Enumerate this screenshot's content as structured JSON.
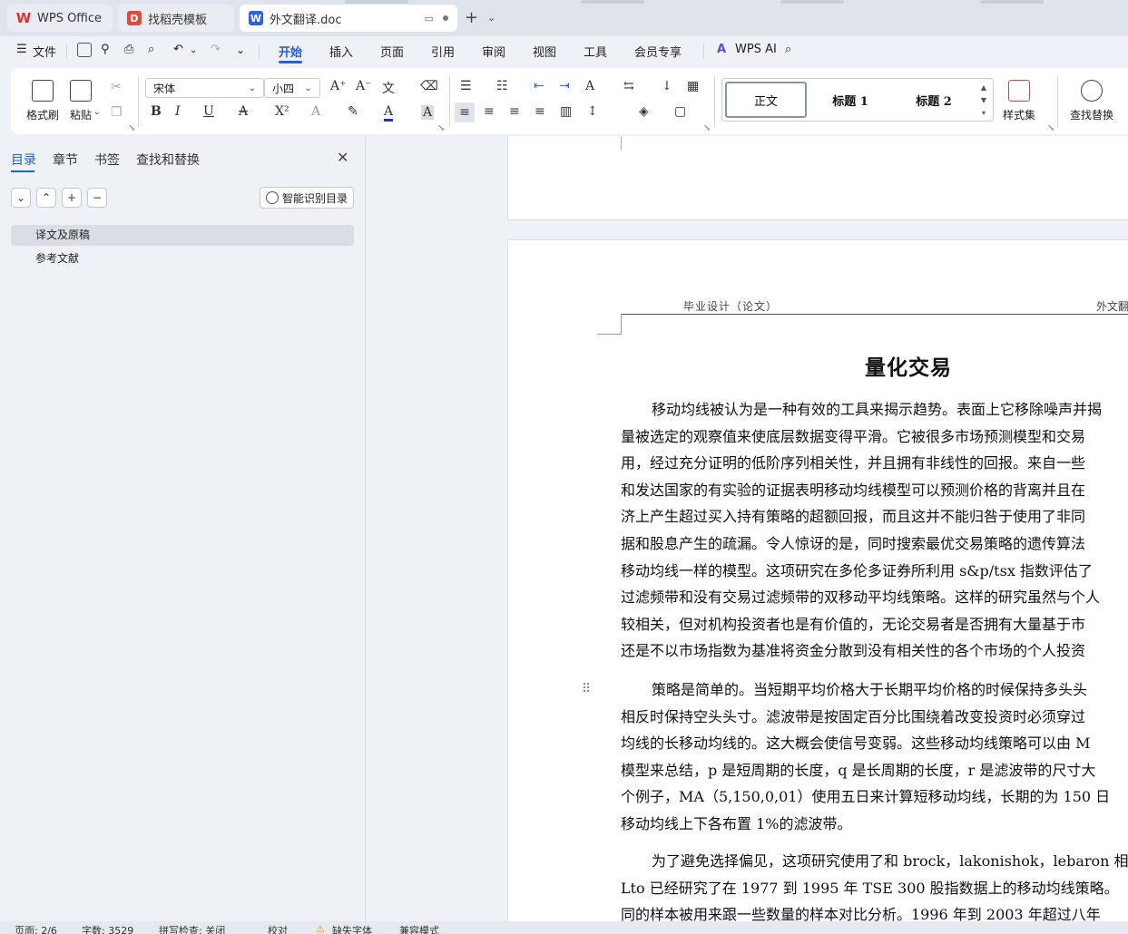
{
  "tabs": [
    {
      "label": "WPS Office"
    },
    {
      "label": "找稻壳模板"
    },
    {
      "label": "外文翻译.doc"
    }
  ],
  "menu": {
    "file": "文件",
    "items": [
      "开始",
      "插入",
      "页面",
      "引用",
      "审阅",
      "视图",
      "工具",
      "会员专享"
    ],
    "active": "开始",
    "wps_ai": "WPS AI"
  },
  "ribbon": {
    "format_painter": "格式刷",
    "paste": "粘贴",
    "font_name": "宋体",
    "font_size": "小四",
    "styles": [
      "正文",
      "标题 1",
      "标题 2"
    ],
    "style_set": "样式集",
    "find_replace": "查找替换"
  },
  "nav": {
    "tabs": [
      "目录",
      "章节",
      "书签",
      "查找和替换"
    ],
    "smart_toc": "智能识别目录",
    "toc_items": [
      "译文及原稿",
      "参考文献"
    ]
  },
  "doc": {
    "header_left": "毕业设计（论文）",
    "header_right": "外文翻",
    "title": "量化交易",
    "paragraphs": [
      [
        "移动均线被认为是一种有效的工具来揭示趋势。表面上它移除噪声并揭",
        "量被选定的观察值来使底层数据变得平滑。它被很多市场预测模型和交易",
        "用，经过充分证明的低阶序列相关性，并且拥有非线性的回报。来自一些",
        "和发达国家的有实验的证据表明移动均线模型可以预测价格的背离并且在",
        "济上产生超过买入持有策略的超额回报，而且这并不能归咎于使用了非同",
        "据和股息产生的疏漏。令人惊讶的是，同时搜索最优交易策略的遗传算法",
        "移动均线一样的模型。这项研究在多伦多证券所利用 s&p/tsx 指数评估了",
        "过滤频带和没有交易过滤频带的双移动平均线策略。这样的研究虽然与个人",
        "较相关，但对机构投资者也是有价值的，无论交易者是否拥有大量基于市",
        "还是不以市场指数为基准将资金分散到没有相关性的各个市场的个人投资"
      ],
      [
        "策略是简单的。当短期平均价格大于长期平均价格的时候保持多头头",
        "相反时保持空头头寸。滤波带是按固定百分比围绕着改变投资时必须穿过",
        "均线的长移动均线的。这大概会使信号变弱。这些移动均线策略可以由 M",
        "模型来总结，p 是短周期的长度，q 是长周期的长度，r 是滤波带的尺寸大",
        "个例子，MA（5,150,0,01）使用五日来计算短移动均线，长期的为 150 日",
        "移动均线上下各布置 1%的滤波带。"
      ],
      [
        "为了避免选择偏见，这项研究使用了和 brock，lakonishok，lebaron 相",
        "Lto 已经研究了在 1977 到 1995 年 TSE 300 股指数据上的移动均线策略。",
        "同的样本被用来跟一些数量的样本对比分析。1996 年到 2003 年超过八年"
      ]
    ]
  },
  "status": {
    "page": "页面: 2/6",
    "words": "字数: 3529",
    "spell": "拼写检查: 关闭",
    "proof": "校对",
    "missing_font": "缺失字体",
    "compat": "兼容模式"
  }
}
